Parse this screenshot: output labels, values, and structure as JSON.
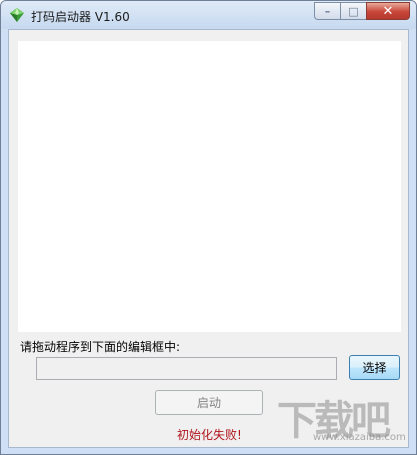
{
  "window": {
    "title": "打码启动器 V1.60",
    "icon": "green-gem-app-icon",
    "caption_buttons": {
      "minimize": "minimize-icon",
      "maximize": "maximize-icon",
      "close": "close-icon"
    }
  },
  "main": {
    "prompt_label": "请拖动程序到下面的编辑框中:",
    "path_input": {
      "value": "",
      "placeholder": ""
    },
    "choose_button_label": "选择",
    "start_button_label": "启动",
    "status_text": "初始化失败!"
  },
  "watermark": {
    "text": "下载吧",
    "url": "www.xiazaiba.com"
  },
  "colors": {
    "status_error": "#b0151c",
    "titlebar": "#c6d9f0",
    "window_bg": "#f0f0f0"
  }
}
